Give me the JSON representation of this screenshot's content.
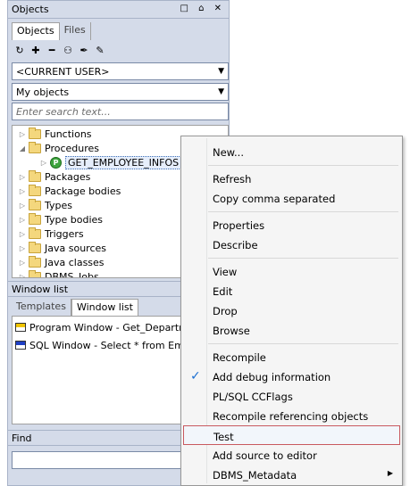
{
  "panel": {
    "title": "Objects",
    "title_controls": "□ ⌂ ✕",
    "tabs": [
      "Objects",
      "Files"
    ],
    "toolbar_icons": [
      "refresh-icon",
      "new-icon",
      "delete-icon",
      "find-icon",
      "filter-icon",
      "filter-edit-icon"
    ],
    "user_combo": "<CURRENT USER>",
    "filter_combo": "My objects",
    "search_placeholder": "Enter search text...",
    "tree": [
      {
        "label": "Functions",
        "expander": "▷",
        "type": "folder"
      },
      {
        "label": "Procedures",
        "expander": "◢",
        "type": "folder"
      },
      {
        "label": "GET_EMPLOYEE_INFOS",
        "expander": "▷",
        "type": "procedure"
      },
      {
        "label": "Packages",
        "expander": "▷",
        "type": "folder"
      },
      {
        "label": "Package bodies",
        "expander": "▷",
        "type": "folder"
      },
      {
        "label": "Types",
        "expander": "▷",
        "type": "folder"
      },
      {
        "label": "Type bodies",
        "expander": "▷",
        "type": "folder"
      },
      {
        "label": "Triggers",
        "expander": "▷",
        "type": "folder"
      },
      {
        "label": "Java sources",
        "expander": "▷",
        "type": "folder"
      },
      {
        "label": "Java classes",
        "expander": "▷",
        "type": "folder"
      },
      {
        "label": "DBMS_Jobs",
        "expander": "▷",
        "type": "folder"
      }
    ],
    "window_list_header": "Window list",
    "bottom_tabs": [
      "Templates",
      "Window list"
    ],
    "window_items": [
      {
        "label": "Program Window - Get_Department_",
        "band_color": "#f0c400"
      },
      {
        "label": "SQL Window - Select * from Employe",
        "band_color": "#1f3fc4"
      }
    ],
    "find_label": "Find"
  },
  "context_menu": {
    "items": [
      {
        "label": "New...",
        "row": 0
      },
      {
        "label": "Refresh",
        "row": 1
      },
      {
        "label": "Copy comma separated",
        "row": 2
      },
      {
        "label": "Properties",
        "row": 3
      },
      {
        "label": "Describe",
        "row": 4
      },
      {
        "label": "View",
        "row": 5
      },
      {
        "label": "Edit",
        "row": 6
      },
      {
        "label": "Drop",
        "row": 7
      },
      {
        "label": "Browse",
        "row": 8
      },
      {
        "label": "Recompile",
        "row": 9
      },
      {
        "label": "Add debug information",
        "row": 10,
        "checked": true
      },
      {
        "label": "PL/SQL CCFlags",
        "row": 11
      },
      {
        "label": "Recompile referencing objects",
        "row": 12
      },
      {
        "label": "Test",
        "row": 13,
        "highlighted": true
      },
      {
        "label": "Add source to editor",
        "row": 14
      },
      {
        "label": "DBMS_Metadata",
        "row": 15,
        "submenu": true
      }
    ],
    "check_glyph": "✓",
    "submenu_glyph": "▶"
  },
  "colors": {
    "panel_bg": "#d4dbe9",
    "menu_highlight_border": "#c8595f",
    "check_color": "#1c6fd1"
  }
}
